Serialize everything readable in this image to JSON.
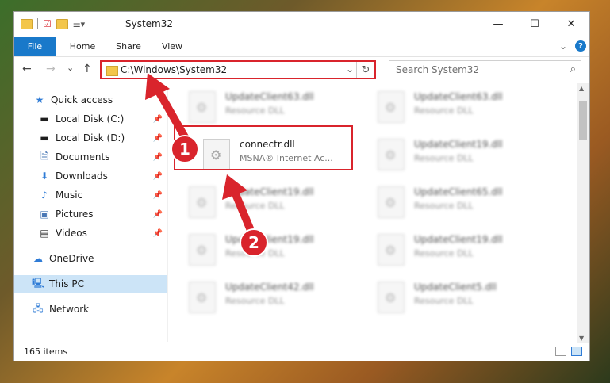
{
  "window": {
    "title": "System32",
    "minimize": "—",
    "maximize": "☐",
    "close": "✕"
  },
  "ribbon": {
    "tabs": [
      "File",
      "Home",
      "Share",
      "View"
    ],
    "expand": "⌄",
    "help": "?"
  },
  "addressbar": {
    "back": "←",
    "forward": "→",
    "recent": "⌄",
    "up": "↑",
    "path": "C:\\Windows\\System32",
    "dropdown": "⌄",
    "refresh": "↻",
    "search_placeholder": "Search System32",
    "search_icon": "⌕"
  },
  "navpane": {
    "items": [
      {
        "label": "Quick access",
        "icon": "star-icon"
      },
      {
        "label": "Local Disk (C:)",
        "icon": "drive-icon",
        "pinned": true
      },
      {
        "label": "Local Disk (D:)",
        "icon": "drive-icon",
        "pinned": true
      },
      {
        "label": "Documents",
        "icon": "documents-icon",
        "pinned": true
      },
      {
        "label": "Downloads",
        "icon": "download-icon",
        "pinned": true
      },
      {
        "label": "Music",
        "icon": "music-icon",
        "pinned": true
      },
      {
        "label": "Pictures",
        "icon": "pictures-icon",
        "pinned": true
      },
      {
        "label": "Videos",
        "icon": "videos-icon",
        "pinned": true
      },
      {
        "label": "OneDrive",
        "icon": "cloud-icon"
      },
      {
        "label": "This PC",
        "icon": "computer-icon",
        "selected": true
      },
      {
        "label": "Network",
        "icon": "network-icon"
      }
    ]
  },
  "files": [
    {
      "name": "UpdateClient63.dll",
      "desc": "Resource DLL"
    },
    {
      "name": "UpdateClient63.dll",
      "desc": "Resource DLL"
    },
    {
      "name": "connectr.dll",
      "desc": "MSNA® Internet Ac..."
    },
    {
      "name": "UpdateClient19.dll",
      "desc": "Resource DLL"
    },
    {
      "name": "UpdateClient19.dll",
      "desc": "Resource DLL"
    },
    {
      "name": "UpdateClient65.dll",
      "desc": "Resource DLL"
    },
    {
      "name": "UpdateClient19.dll",
      "desc": "Resource DLL"
    },
    {
      "name": "UpdateClient19.dll",
      "desc": "Resource DLL"
    },
    {
      "name": "UpdateClient42.dll",
      "desc": "Resource DLL"
    },
    {
      "name": "UpdateClient5.dll",
      "desc": "Resource DLL"
    }
  ],
  "status": {
    "item_count": "165 items"
  },
  "callouts": {
    "step1": "1",
    "step2": "2"
  },
  "colors": {
    "accent": "#1979ca",
    "annotation_red": "#d9242c",
    "selection": "#cce4f7"
  }
}
